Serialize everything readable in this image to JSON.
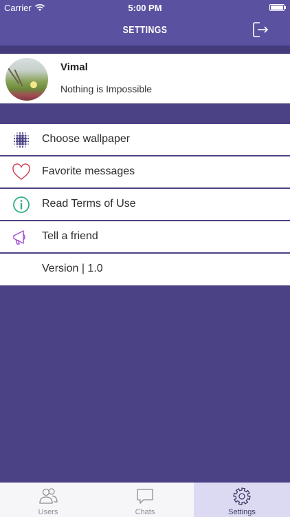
{
  "status_bar": {
    "carrier": "Carrier",
    "time": "5:00 PM"
  },
  "nav": {
    "title": "SETTINGS"
  },
  "profile": {
    "name": "Vimal",
    "status": "Nothing is Impossible"
  },
  "menu": {
    "items": [
      {
        "label": "Choose wallpaper",
        "icon": "dots-grid-icon",
        "color": "#4a4285"
      },
      {
        "label": "Favorite messages",
        "icon": "heart-icon",
        "color": "#d0475a"
      },
      {
        "label": "Read Terms of Use",
        "icon": "info-icon",
        "color": "#2fae86"
      },
      {
        "label": "Tell a friend",
        "icon": "megaphone-icon",
        "color": "#a34bd0"
      },
      {
        "label": "Version | 1.0"
      }
    ]
  },
  "tabs": [
    {
      "label": "Users",
      "icon": "users-icon"
    },
    {
      "label": "Chats",
      "icon": "chat-bubble-icon"
    },
    {
      "label": "Settings",
      "icon": "gear-icon",
      "selected": true
    }
  ],
  "colors": {
    "primary": "#5a52a1",
    "background": "#4a4285",
    "tab_selected": "#dcdaf3"
  }
}
